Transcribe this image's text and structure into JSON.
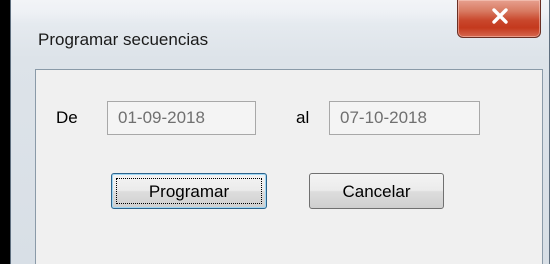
{
  "window": {
    "title": "Programar secuencias",
    "close_icon": "close-icon"
  },
  "form": {
    "from_label": "De",
    "from_value": "01-09-2018",
    "to_label": "al",
    "to_value": "07-10-2018"
  },
  "buttons": {
    "primary_label": "Programar",
    "cancel_label": "Cancelar"
  },
  "colors": {
    "close_button": "#c9472c",
    "title_bar": "#e5eaef",
    "client_area": "#f0f0f0",
    "default_button_border": "#2c628b"
  }
}
